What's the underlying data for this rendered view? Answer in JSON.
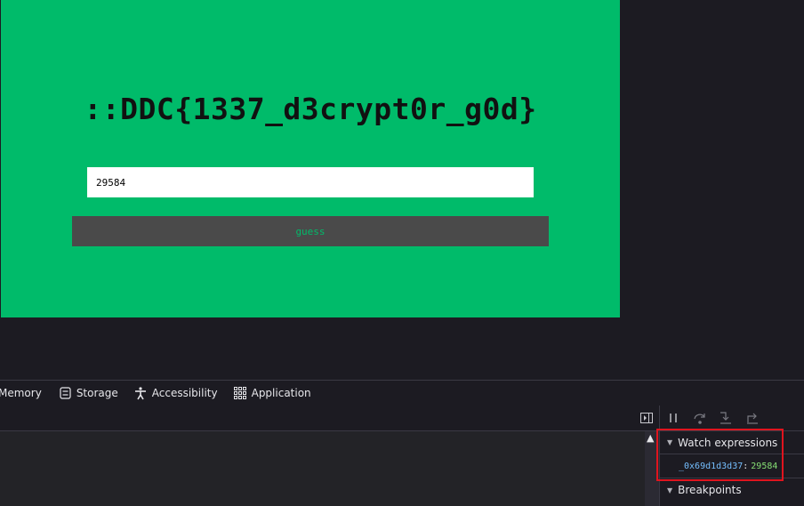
{
  "game": {
    "flag_text": "::DDC{1337_d3crypt0r_g0d}",
    "input_value": "29584",
    "button_label": "guess",
    "panel_color": "#00bb6a"
  },
  "devtools": {
    "tabs": [
      {
        "label": "Memory"
      },
      {
        "label": "Storage",
        "icon": "storage-icon"
      },
      {
        "label": "Accessibility",
        "icon": "accessibility-icon"
      },
      {
        "label": "Application",
        "icon": "application-grid-icon"
      }
    ],
    "toolbar_icons": [
      "toggle-sidebar-icon",
      "pause-icon",
      "step-over-icon",
      "step-in-icon",
      "step-out-icon"
    ],
    "watch": {
      "title": "Watch expressions",
      "expression": "_0x69d1d3d37",
      "separator": ":",
      "value": "29584"
    },
    "breakpoints_title": "Breakpoints",
    "highlight_color": "#e0141e"
  }
}
